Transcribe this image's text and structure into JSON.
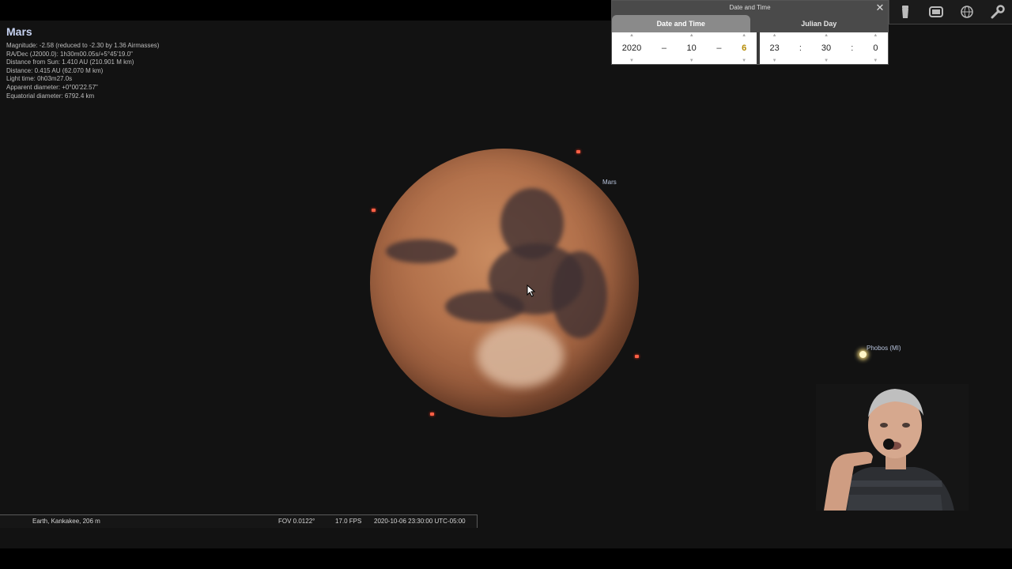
{
  "object_info": {
    "title": "Mars",
    "lines": [
      "Magnitude: -2.58 (reduced to -2.30 by 1.36 Airmasses)",
      "RA/Dec (J2000.0): 1h30m00.05s/+5°45'19.0\"",
      "Distance from Sun: 1.410 AU (210.901 M km)",
      "Distance: 0.415 AU (62.070 M km)",
      "Light time: 0h03m27.0s",
      "Apparent diameter: +0°00'22.57\"",
      "Equatorial diameter: 6792.4 km"
    ]
  },
  "sky_labels": {
    "mars": "Mars",
    "phobos": "Phobos (MI)"
  },
  "date_time_dialog": {
    "title": "Date and Time",
    "close_icon": "close-icon",
    "tabs": [
      "Date and Time",
      "Julian Day"
    ],
    "active_tab": 0,
    "date": {
      "year": "2020",
      "month": "10",
      "day": "6"
    },
    "time": {
      "hour": "23",
      "minute": "30",
      "second": "0"
    },
    "date_sep": "–",
    "time_sep": ":"
  },
  "toolbar": {
    "icons": [
      "flashlight-icon",
      "screen-icon",
      "sky-grid-icon",
      "wrench-icon"
    ]
  },
  "status_bar": {
    "location": "Earth, Kankakee, 206 m",
    "fov": "FOV 0.0122°",
    "fps": "17.0 FPS",
    "datetime": "2020-10-06 23:30:00 UTC-05:00"
  }
}
